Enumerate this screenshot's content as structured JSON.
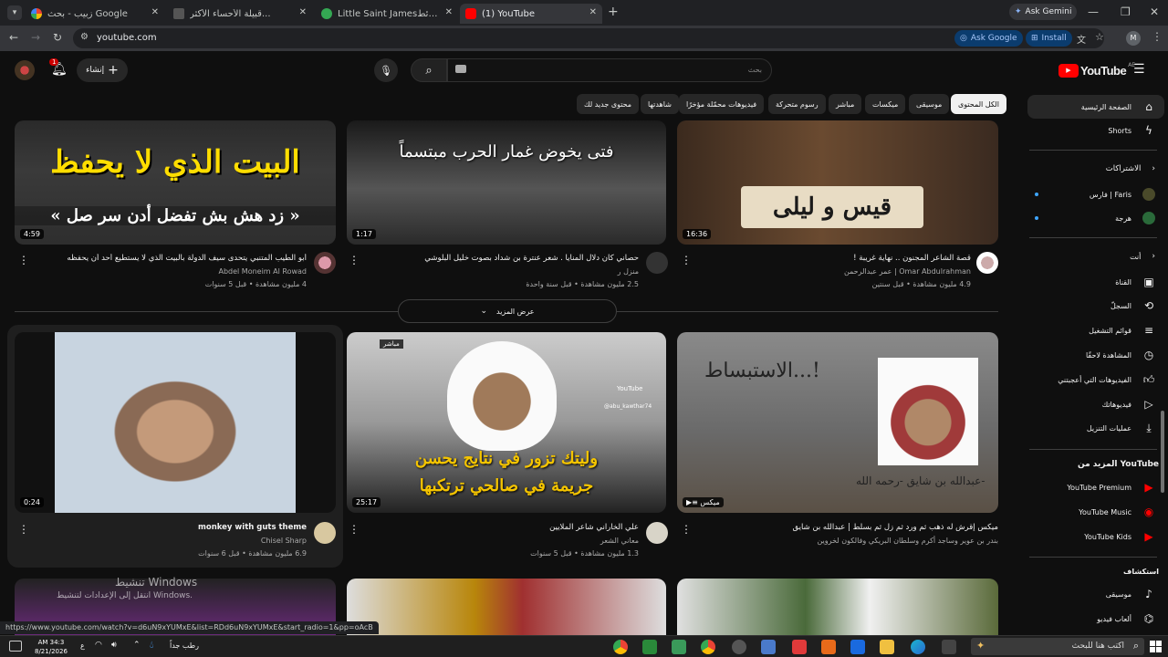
{
  "browser": {
    "tabs": [
      {
        "title": "زبيب - بحث Google",
        "active": false
      },
      {
        "title": "قبيلة الأحساء الأكثر...",
        "active": false
      },
      {
        "title": "Little Saint James‎خرائط - Goo...",
        "active": false
      },
      {
        "title": "(1) YouTube",
        "active": true
      }
    ],
    "ask_gemini": "Ask Gemini",
    "url": "youtube.com",
    "ask_google": "Ask Google",
    "install": "Install",
    "profile_letter": "M",
    "status_url": "https://www.youtube.com/watch?v=d6uN9xYUMxE&list=RDd6uN9xYUMxE&start_radio=1&pp=oAcB"
  },
  "header": {
    "logo": "YouTube",
    "region": "AE",
    "search_placeholder": "بحث",
    "create_label": "إنشاء",
    "notif_count": "1"
  },
  "chips": [
    "الكل المحتوى",
    "موسيقى",
    "ميكسات",
    "مباشر",
    "رسوم متحركة",
    "فيديوهات محمّلة مؤخرًا",
    "شاهدتها",
    "محتوى جديد لك"
  ],
  "sidebar": {
    "home": "الصفحة الرئيسية",
    "shorts": "Shorts",
    "subs_head": "الاشتراكات",
    "subs": [
      "فارس | Faris",
      "هرجة"
    ],
    "you_head": "أنت",
    "you_items": [
      "القناة",
      "السجلّ",
      "قوائم التشغيل",
      "المشاهدة لاحقًا",
      "الفيديوهات التي أعجبتني",
      "فيديوهاتك",
      "عمليات التنزيل"
    ],
    "more_head": "المزيد من YouTube",
    "more_items": [
      "YouTube Premium",
      "YouTube Music",
      "YouTube Kids"
    ],
    "explore_head": "استكشاف",
    "explore_items": [
      "موسيقى",
      "ألعاب فيديو"
    ]
  },
  "row1": [
    {
      "thumb_text": "البيت الذي لا يحفظ",
      "thumb_text2": "« زد هش بش تفضل أدن سر صل »",
      "duration": "4:59",
      "title": "أبو الطيب المتنبي يتحدى سيف الدولة بالبيت الذي لا يستطيع أحد أن يحفظه",
      "channel": "Abdel Moneim Al Rowad",
      "meta": "4 مليون مشاهدة • قبل 5 سنوات"
    },
    {
      "thumb_text": "فتى يخوض غمار الحرب مبتسماً",
      "duration": "1:17",
      "title": "حصاني كان دلال المنايا . شعر عنترة بن شداد بصوت خليل البلوشي",
      "channel": "منزل ر",
      "meta": "2.5 مليون مشاهدة • قبل سنة واحدة"
    },
    {
      "thumb_text": "قيس و ليلى",
      "duration": "16:36",
      "title": "قصة الشاعر المجنون .. نهاية غريبة !",
      "channel": "Omar Abdulrahman | عمر عبدالرحمن",
      "meta": "4.9 مليون مشاهدة • قبل سنتين"
    }
  ],
  "show_more": "عرض المزيد",
  "row2": [
    {
      "duration": "0:24",
      "title": "monkey with guts theme",
      "channel": "Chisel Sharp",
      "meta": "6.9 مليون مشاهدة • قبل 6 سنوات"
    },
    {
      "thumb_text": "وليتك تزور في نتايج يحسن",
      "thumb_text2": "جريمة في صالحي ترتكبها",
      "live": "مباشر",
      "yt_label": "YouTube",
      "handle": "@abu_kawthar74",
      "duration": "25:17",
      "title": "علي الخاراني شاعر الملايين",
      "channel": "معاني الشعر",
      "meta": "1.3 مليون مشاهدة • قبل 5 سنوات"
    },
    {
      "thumb_text": "الاستبساط...!",
      "thumb_text2": "عبدالله بن شايق -رحمه الله-",
      "mix_label": "ميكس",
      "title": "ميكس إقرش له ذهب ثم ورد ثم زل ثم بسلط | عبدالله بن شايق",
      "channel": "بندر بن عوير وساجد أكرم وسلطان البريكي وفالكون لخروين"
    }
  ],
  "activation": {
    "line1": "تنشيط Windows",
    "line2": "انتقل إلى الإعدادات لتنشيط Windows."
  },
  "taskbar": {
    "time": "AM 34:3",
    "date": "8/21/2026",
    "weather": "رطب جداً",
    "search_placeholder": "اكتب هنا للبحث"
  }
}
